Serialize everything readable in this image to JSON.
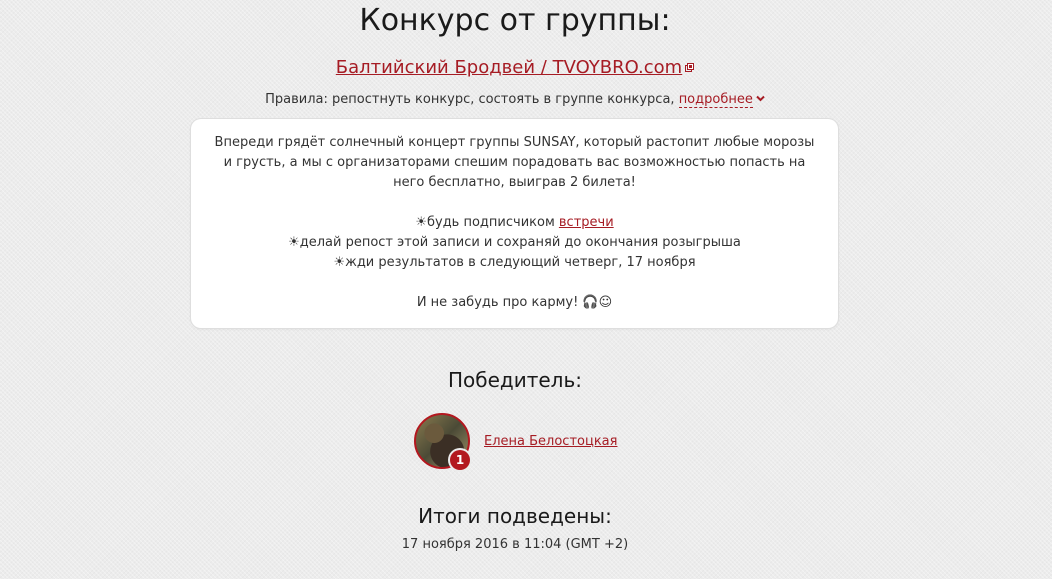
{
  "contest": {
    "title": "Конкурс от группы:",
    "group_link": "Балтийский Бродвей / TVOYBRO.com",
    "rules_prefix": "Правила: репостнуть конкурс, состоять в группе конкурса,",
    "more_link": "подробнее",
    "description": {
      "intro": "Впереди грядёт солнечный концерт группы SUNSAY, который растопит любые морозы и грусть, а мы с организаторами спешим порадовать вас возможностью попасть на него бесплатно, выиграв 2 билета!",
      "item1_prefix": "☀будь подписчиком ",
      "item1_link": "встречи",
      "item2": "☀делай репост этой записи и сохраняй до окончания розыгрыша",
      "item3": "☀жди результатов в следующий четверг, 17 ноября",
      "outro": "И не забудь про карму! 🎧☺"
    }
  },
  "winner": {
    "title": "Победитель:",
    "name": "Елена Белостоцкая",
    "rank": "1"
  },
  "results": {
    "title": "Итоги подведены:",
    "date": "17 ноября 2016 в 11:04 (GMT +2)"
  },
  "colors": {
    "accent": "#a61c24",
    "badge": "#b3181f",
    "background": "#ececec"
  },
  "icons": {
    "external": "external-link-icon",
    "chevron": "chevron-down-icon"
  }
}
